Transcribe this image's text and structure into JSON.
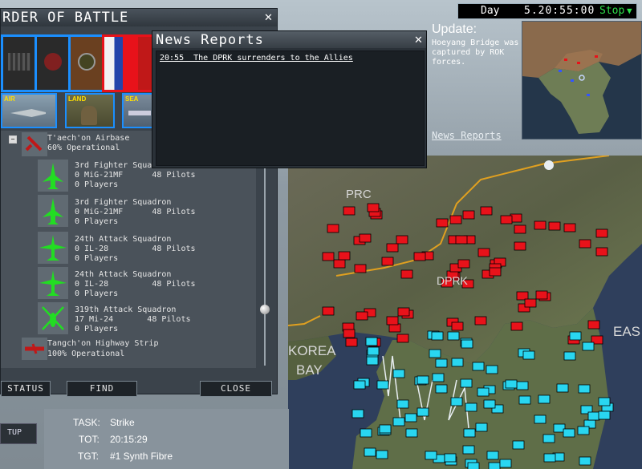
{
  "header": {
    "day_label": "Day",
    "time": "5.20:55:00",
    "stop_label": "Stop"
  },
  "update": {
    "heading": "Update:",
    "body": "Hoeyang Bridge was captured by ROK forces.",
    "link": "News Reports"
  },
  "map": {
    "labels": [
      "PRC",
      "DPRK",
      "KOREA",
      "BAY",
      "EAS"
    ]
  },
  "task": {
    "task_label": "TASK:",
    "task_value": "Strike",
    "tot_label": "TOT:",
    "tot_value": "20:15:29",
    "tgt_label": "TGT:",
    "tgt_value": "#1 Synth Fibre",
    "side_button": "TUP"
  },
  "order_of_battle": {
    "title": "RDER OF BATTLE",
    "categories": [
      "AIR",
      "LAND",
      "SEA"
    ],
    "units": [
      {
        "line1": "T'aech'on Airbase",
        "line2": "60% Operational"
      },
      {
        "line1": "3rd Fighter Squadron",
        "line2": "0 MiG-21MF      48 Pilots",
        "line3": "0 Players"
      },
      {
        "line1": "3rd Fighter Squadron",
        "line2": "0 MiG-21MF      48 Pilots",
        "line3": "0 Players"
      },
      {
        "line1": "24th Attack Squadron",
        "line2": "0 IL-28         48 Pilots",
        "line3": "0 Players"
      },
      {
        "line1": "24th Attack Squadron",
        "line2": "0 IL-28         48 Pilots",
        "line3": "0 Players"
      },
      {
        "line1": "319th Attack Squadron",
        "line2": "17 Mi-24       48 Pilots",
        "line3": "0 Players"
      },
      {
        "line1": "Tangch'on Highway Strip",
        "line2": "100% Operational"
      }
    ],
    "buttons": {
      "status": "STATUS",
      "find": "FIND",
      "close": "CLOSE"
    }
  },
  "news": {
    "title": "News Reports",
    "items": [
      "20:55  The DPRK surrenders to the Allies"
    ]
  },
  "colors": {
    "accent_blue": "#1b8fff",
    "stop_green": "#2ee04a",
    "enemy_red": "#e8121a",
    "ally_cyan": "#29d6f0",
    "front_line": "#e0a020"
  }
}
